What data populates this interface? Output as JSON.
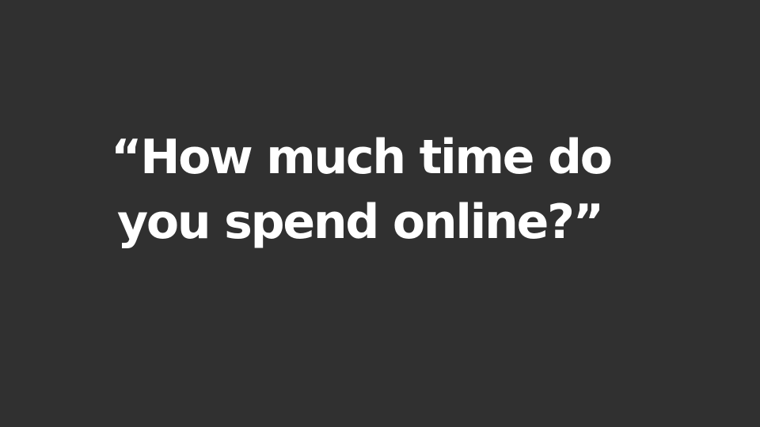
{
  "slide": {
    "background_color": "#303030",
    "text_color": "#ffffff",
    "quote": {
      "line_1": "“How much time do",
      "line_2": "you spend online?”"
    }
  }
}
